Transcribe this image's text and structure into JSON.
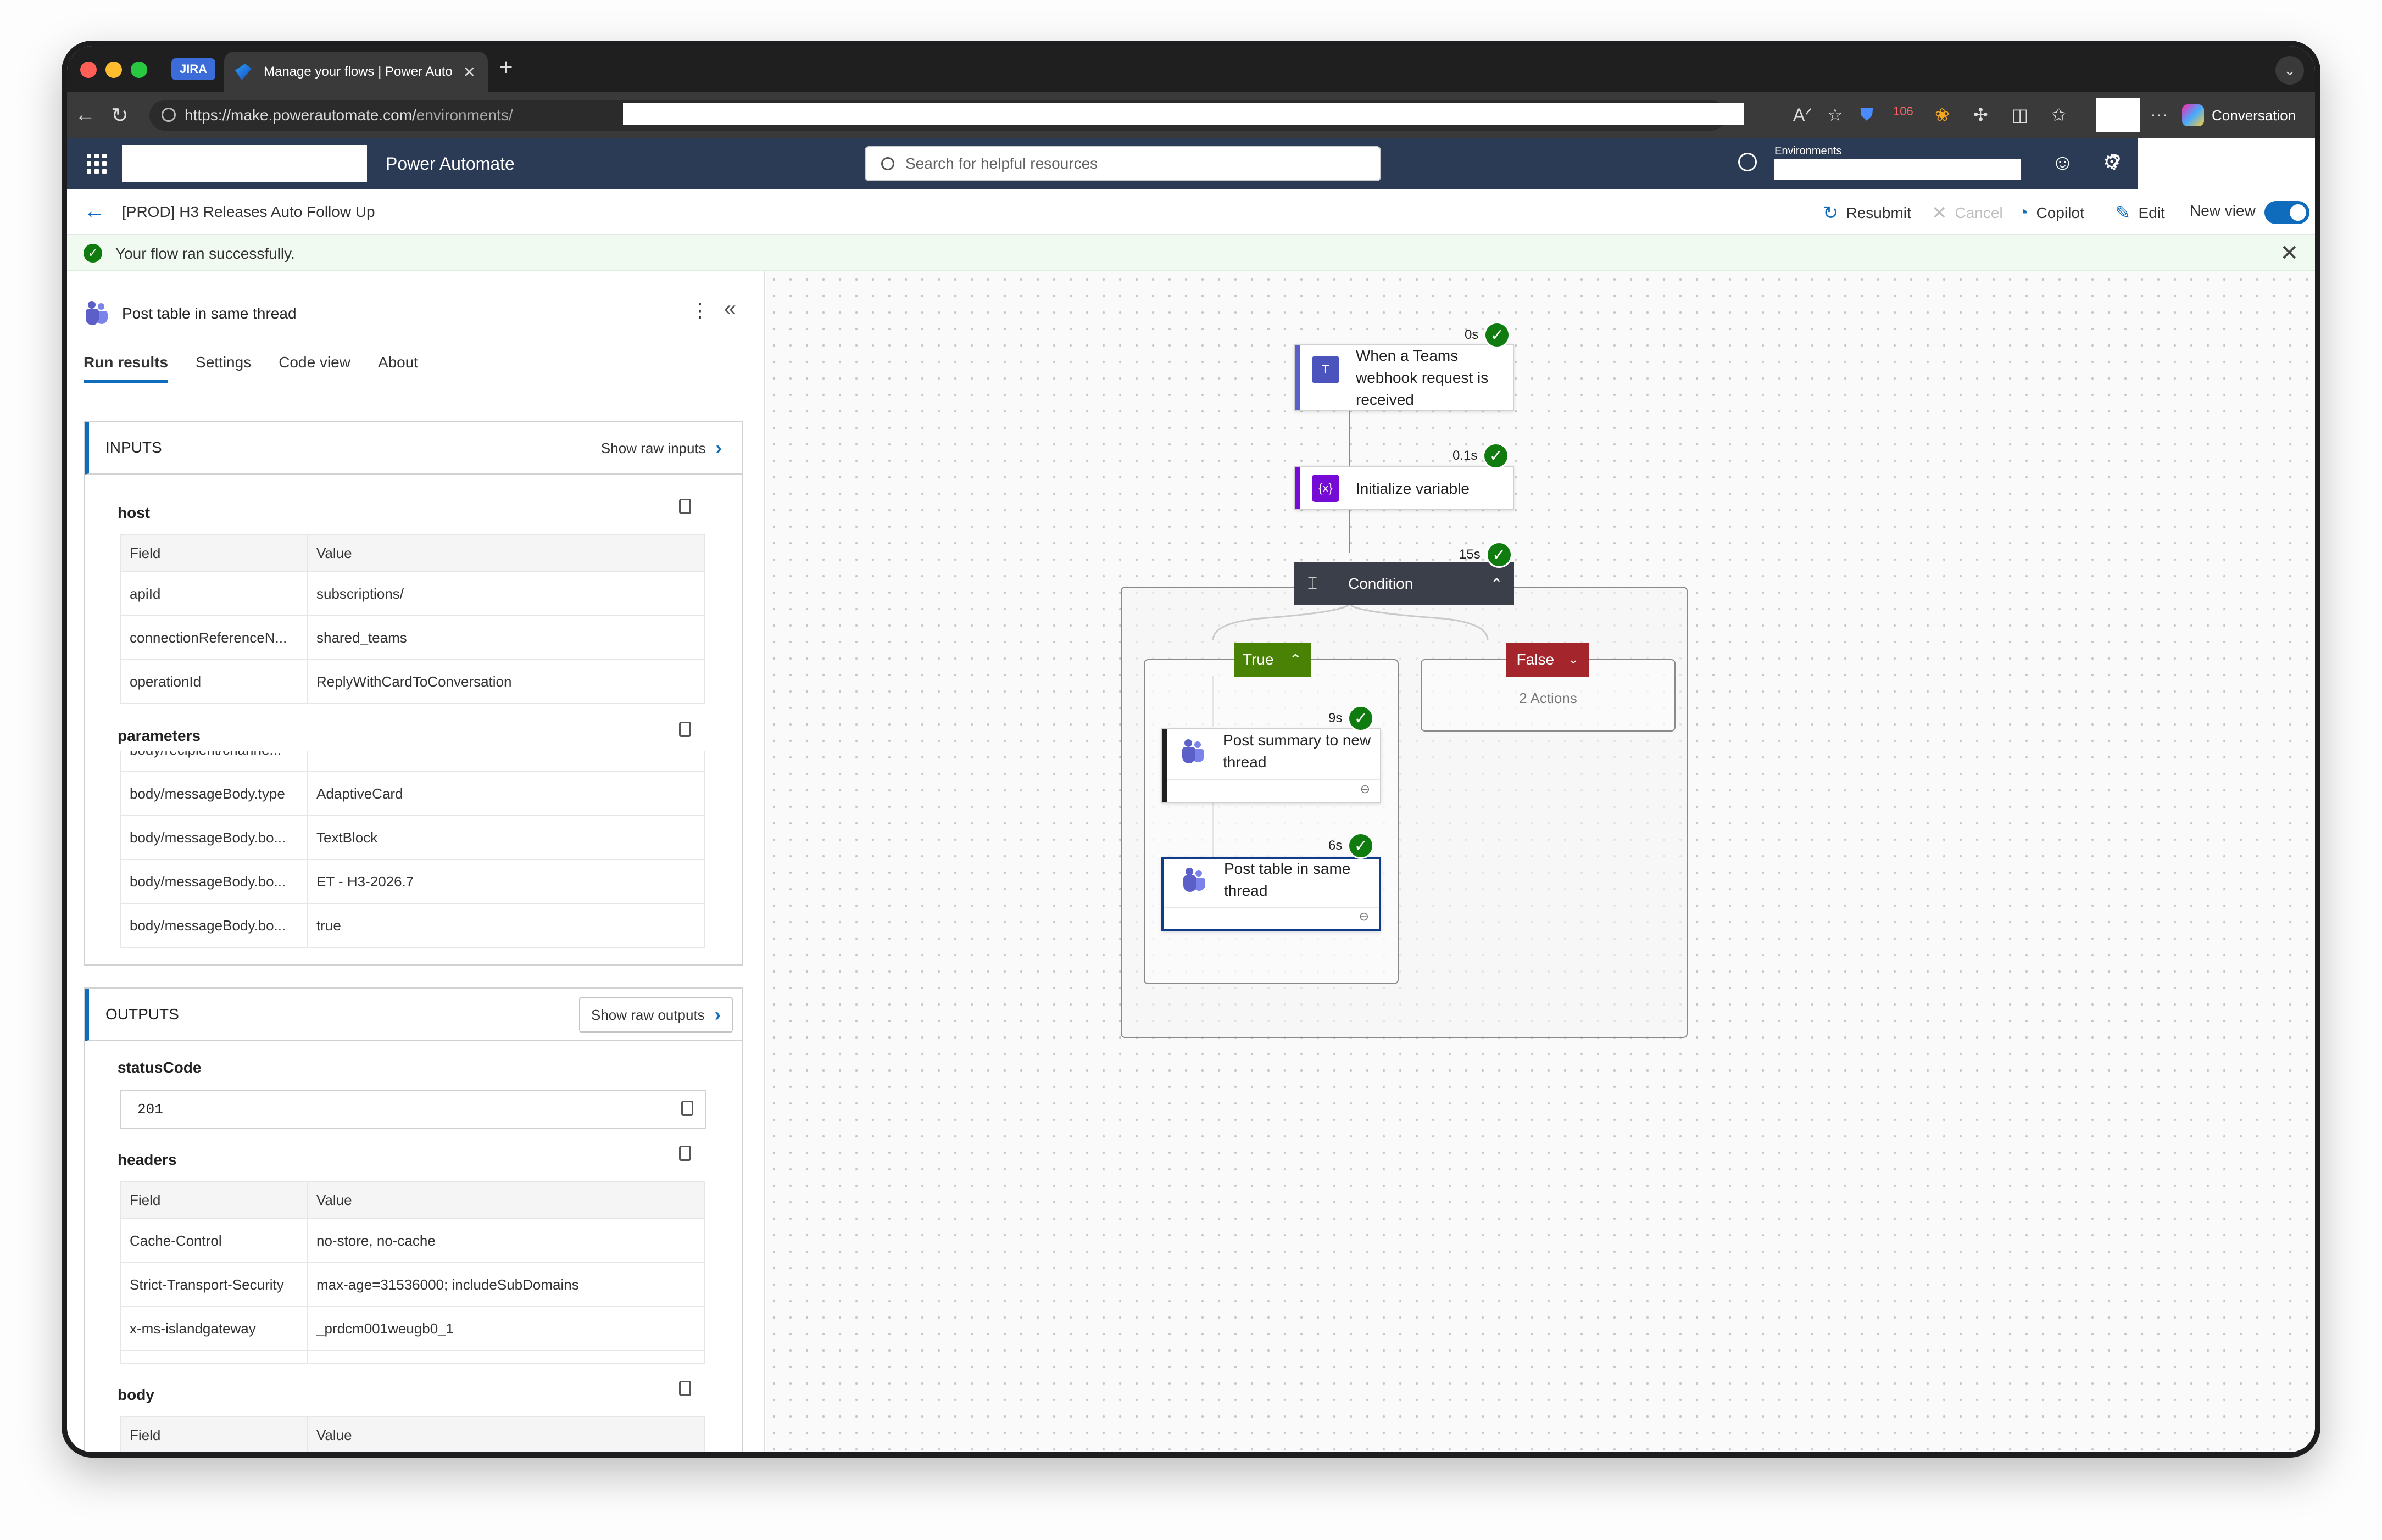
{
  "browser": {
    "tab_jira": "JIRA",
    "tab_active": "Manage your flows | Power Auto",
    "url_base": "https://make.powerautomate.com/",
    "url_rest": "environments/",
    "conversation": "Conversation",
    "badge_count": "106"
  },
  "app": {
    "title": "Power Automate",
    "search_placeholder": "Search for helpful resources",
    "env_label": "Environments"
  },
  "cmdbar": {
    "flow_title": "[PROD] H3 Releases Auto Follow Up",
    "resubmit": "Resubmit",
    "cancel": "Cancel",
    "copilot": "Copilot",
    "edit": "Edit",
    "new_view": "New view"
  },
  "banner": {
    "message": "Your flow ran successfully."
  },
  "panel": {
    "title": "Post table in same thread",
    "tabs": [
      "Run results",
      "Settings",
      "Code view",
      "About"
    ],
    "inputs": {
      "label": "INPUTS",
      "raw_button": "Show raw inputs",
      "host_label": "host",
      "header": [
        "Field",
        "Value"
      ],
      "host_rows": [
        [
          "apiId",
          "subscriptions/"
        ],
        [
          "connectionReferenceN...",
          "shared_teams"
        ],
        [
          "operationId",
          "ReplyWithCardToConversation"
        ]
      ],
      "parameters_label": "parameters",
      "param_rows": [
        [
          "body/recipient/channe...",
          ""
        ],
        [
          "body/messageBody.type",
          "AdaptiveCard"
        ],
        [
          "body/messageBody.bo...",
          "TextBlock"
        ],
        [
          "body/messageBody.bo...",
          "ET - H3-2026.7"
        ],
        [
          "body/messageBody.bo...",
          "true"
        ]
      ]
    },
    "outputs": {
      "label": "OUTPUTS",
      "raw_button": "Show raw outputs",
      "status_label": "statusCode",
      "status_value": "201",
      "headers_label": "headers",
      "header": [
        "Field",
        "Value"
      ],
      "header_rows": [
        [
          "Cache-Control",
          "no-store, no-cache"
        ],
        [
          "Strict-Transport-Security",
          "max-age=31536000; includeSubDomains"
        ],
        [
          "x-ms-islandgateway",
          "_prdcm001weugb0_1"
        ]
      ],
      "body_label": "body",
      "body_header": [
        "Field",
        "Value"
      ]
    }
  },
  "canvas": {
    "trigger": {
      "label": "When a Teams webhook request is received",
      "time": "0s"
    },
    "init_var": {
      "label": "Initialize variable",
      "time": "0.1s"
    },
    "condition": {
      "label": "Condition",
      "time": "15s"
    },
    "true_branch": {
      "label": "True"
    },
    "false_branch": {
      "label": "False",
      "summary": "2 Actions"
    },
    "post_summary": {
      "label": "Post summary to new thread",
      "time": "9s"
    },
    "post_table": {
      "label": "Post table in same thread",
      "time": "6s"
    }
  },
  "colors": {
    "accent": "#0f6cbd",
    "success": "#107c10",
    "true_branch": "#498205",
    "false_branch": "#a4262c",
    "header": "#2b3a55"
  }
}
